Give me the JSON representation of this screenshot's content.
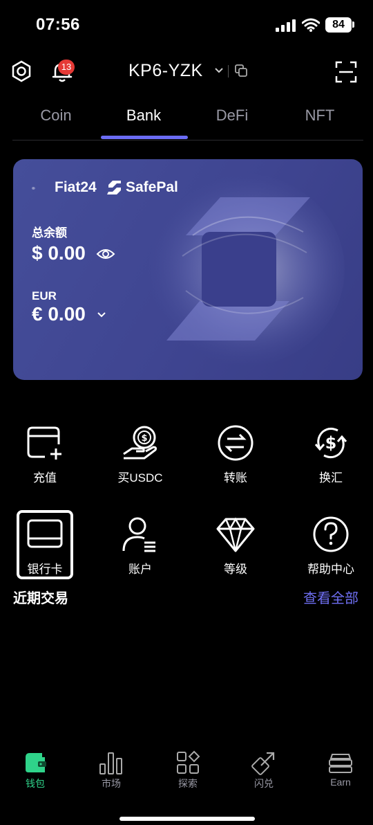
{
  "status_bar": {
    "time": "07:56",
    "battery": "84"
  },
  "header": {
    "wallet_name": "KP6-YZK",
    "notification_count": "13"
  },
  "tabs": [
    {
      "label": "Coin"
    },
    {
      "label": "Bank"
    },
    {
      "label": "DeFi"
    },
    {
      "label": "NFT"
    }
  ],
  "card": {
    "brand_primary": "Fiat24",
    "brand_secondary": "SafePal",
    "total_label": "总余额",
    "total_value": "$ 0.00",
    "currency_label": "EUR",
    "currency_value": "€ 0.00"
  },
  "actions": [
    {
      "label": "充值",
      "icon": "card-add-icon"
    },
    {
      "label": "买USDC",
      "icon": "hand-coin-icon"
    },
    {
      "label": "转账",
      "icon": "transfer-icon"
    },
    {
      "label": "换汇",
      "icon": "exchange-dollar-icon"
    },
    {
      "label": "银行卡",
      "icon": "bank-card-icon"
    },
    {
      "label": "账户",
      "icon": "account-icon"
    },
    {
      "label": "等级",
      "icon": "diamond-icon"
    },
    {
      "label": "帮助中心",
      "icon": "help-icon"
    }
  ],
  "recent": {
    "title": "近期交易",
    "view_all": "查看全部"
  },
  "bottom_nav": [
    {
      "label": "钱包",
      "icon": "wallet-icon"
    },
    {
      "label": "市场",
      "icon": "market-chart-icon"
    },
    {
      "label": "探索",
      "icon": "explore-grid-icon"
    },
    {
      "label": "闪兑",
      "icon": "swap-icon"
    },
    {
      "label": "Earn",
      "icon": "earn-icon"
    }
  ],
  "colors": {
    "accent": "#6b6cf5",
    "card": "#3f4591",
    "active_nav": "#2fd38a",
    "badge": "#e53935"
  }
}
